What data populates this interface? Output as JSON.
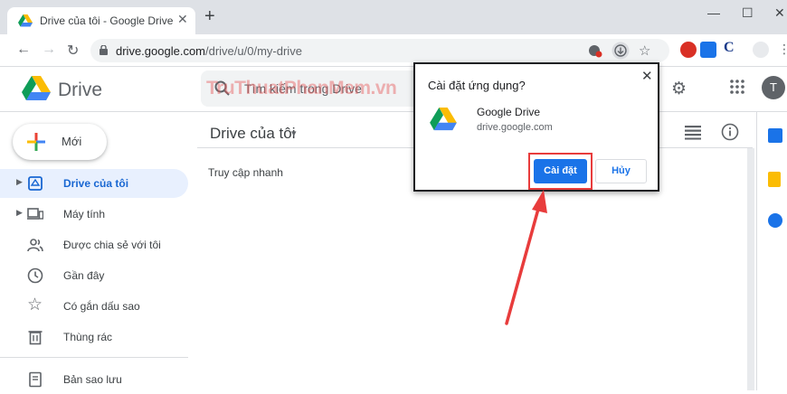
{
  "browser": {
    "tab_title": "Drive của tôi - Google Drive",
    "tab_close": "✕",
    "new_tab": "+",
    "window_min": "—",
    "window_max": "☐",
    "window_close": "✕",
    "url_host": "drive.google.com",
    "url_path": "/drive/u/0/my-drive"
  },
  "header": {
    "app_name": "Drive",
    "search_placeholder": "Tìm kiếm trong Drive",
    "watermark": "TruThuatPhanMem.vn",
    "avatar_letter": "T"
  },
  "sidebar": {
    "new_label": "Mới",
    "items": [
      {
        "label": "Drive của tôi",
        "icon": "my-drive-icon",
        "active": true
      },
      {
        "label": "Máy tính",
        "icon": "computer-icon"
      },
      {
        "label": "Được chia sẻ với tôi",
        "icon": "shared-icon"
      },
      {
        "label": "Gần đây",
        "icon": "clock-icon"
      },
      {
        "label": "Có gắn dấu sao",
        "icon": "star-icon"
      },
      {
        "label": "Thùng rác",
        "icon": "trash-icon"
      },
      {
        "label": "Bản sao lưu",
        "icon": "backup-icon"
      }
    ]
  },
  "main": {
    "title": "Drive của tôi",
    "caret": "▾",
    "quick_access": "Truy cập nhanh"
  },
  "dialog": {
    "title": "Cài đặt ứng dụng?",
    "close": "✕",
    "app_name": "Google Drive",
    "app_site": "drive.google.com",
    "install_label": "Cài đặt",
    "cancel_label": "Hủy"
  },
  "colors": {
    "accent": "#1a73e8",
    "annotation": "#e83c3c",
    "active_nav_bg": "#e8f0fe"
  }
}
